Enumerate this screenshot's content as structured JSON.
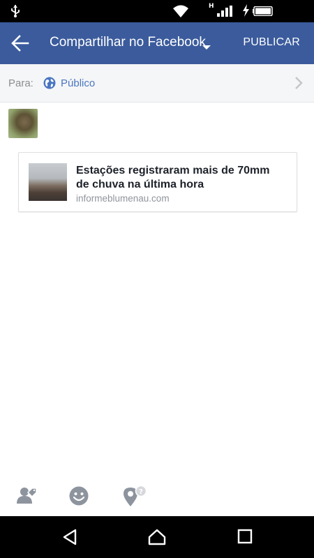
{
  "toolbar": {
    "title": "Compartilhar no Facebook",
    "publish_label": "PUBLICAR"
  },
  "audience": {
    "label": "Para:",
    "value": "Público"
  },
  "link_card": {
    "title": "Estações registraram mais de 70mm de chuva na última hora",
    "domain": "informeblumenau.com"
  },
  "status_bar": {
    "network_type": "H"
  },
  "icons": {
    "back": "arrow-left-icon",
    "caret": "caret-down-icon",
    "globe": "globe-icon",
    "chevron": "chevron-right-icon",
    "tag_people": "tag-people-icon",
    "feeling": "smiley-icon",
    "checkin": "location-pin-icon",
    "nav_back": "nav-back-icon",
    "nav_home": "nav-home-icon",
    "nav_recent": "nav-recent-icon"
  },
  "colors": {
    "toolbar_bg": "#3b5b9c",
    "link_blue": "#4a76c2",
    "status_bar_bg": "#000000"
  }
}
